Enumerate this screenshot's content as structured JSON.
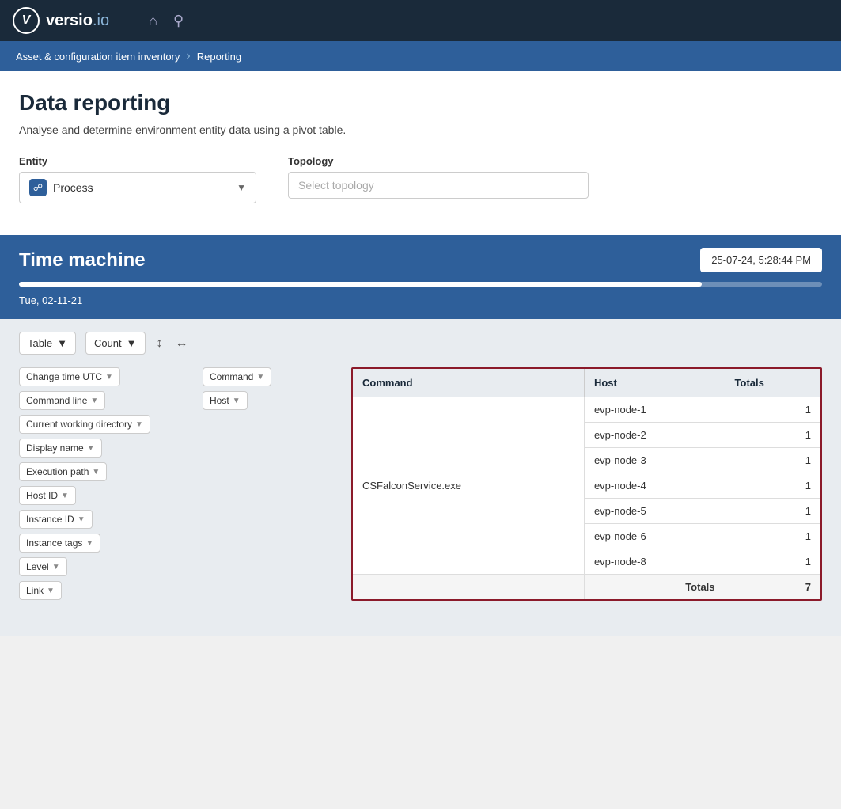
{
  "app": {
    "name": "versio",
    "suffix": ".io"
  },
  "breadcrumb": {
    "parent": "Asset & configuration item inventory",
    "current": "Reporting"
  },
  "page": {
    "title": "Data reporting",
    "description": "Analyse and determine environment entity data using a pivot table."
  },
  "entity_label": "Entity",
  "entity_value": "Process",
  "topology_label": "Topology",
  "topology_placeholder": "Select topology",
  "time_machine": {
    "title": "Time machine",
    "datetime": "25-07-24, 5:28:44 PM",
    "date_label": "Tue, 02-11-21"
  },
  "pivot": {
    "view_type": "Table",
    "aggregate": "Count",
    "fields": [
      {
        "label": "Change time UTC",
        "has_arrow": true
      },
      {
        "label": "Command line",
        "has_arrow": true
      },
      {
        "label": "Current working directory",
        "has_arrow": true
      },
      {
        "label": "Display name",
        "has_arrow": true
      },
      {
        "label": "Execution path",
        "has_arrow": true
      },
      {
        "label": "Host ID",
        "has_arrow": true
      },
      {
        "label": "Instance ID",
        "has_arrow": true
      },
      {
        "label": "Instance tags",
        "has_arrow": true
      },
      {
        "label": "Level",
        "has_arrow": true
      },
      {
        "label": "Link",
        "has_arrow": true
      }
    ],
    "columns": [
      {
        "label": "Command",
        "has_arrow": true
      },
      {
        "label": "Host",
        "has_arrow": true
      }
    ],
    "table": {
      "headers": [
        "Command",
        "Host",
        "Totals"
      ],
      "rows": [
        {
          "command": "CSFalconService.exe",
          "host": "evp-node-1",
          "count": "1"
        },
        {
          "command": "",
          "host": "evp-node-2",
          "count": "1"
        },
        {
          "command": "",
          "host": "evp-node-3",
          "count": "1"
        },
        {
          "command": "",
          "host": "evp-node-4",
          "count": "1"
        },
        {
          "command": "",
          "host": "evp-node-5",
          "count": "1"
        },
        {
          "command": "",
          "host": "evp-node-6",
          "count": "1"
        },
        {
          "command": "",
          "host": "evp-node-8",
          "count": "1"
        }
      ],
      "totals_label": "Totals",
      "totals_value": "7"
    }
  }
}
